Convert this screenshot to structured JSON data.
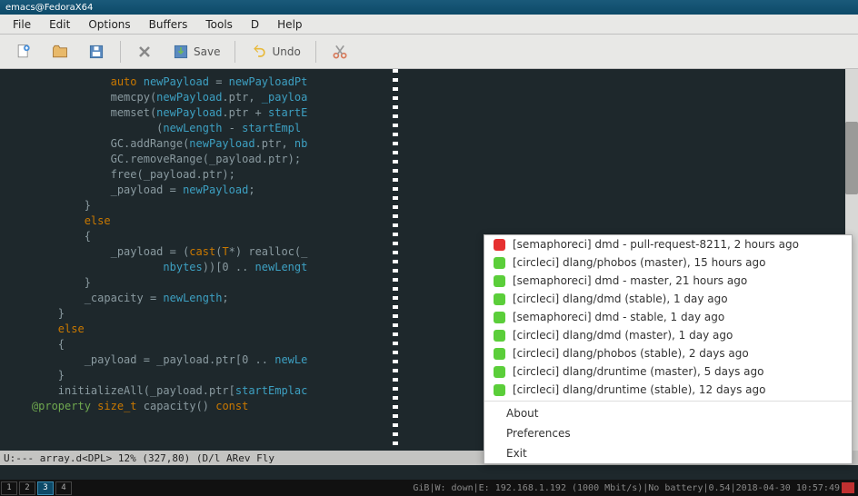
{
  "window": {
    "title": "emacs@FedoraX64"
  },
  "menubar": [
    "File",
    "Edit",
    "Options",
    "Buffers",
    "Tools",
    "D",
    "Help"
  ],
  "toolbar": {
    "new": "",
    "open": "",
    "saveicon": "",
    "close": "",
    "save": "Save",
    "undo": "Undo",
    "cut": ""
  },
  "code": {
    "lines": [
      "                auto newPayload = newPayloadPt",
      "                memcpy(newPayload.ptr, _payloa",
      "                memset(newPayload.ptr + startE",
      "                       (newLength - startEmpl",
      "                GC.addRange(newPayload.ptr, nb",
      "                GC.removeRange(_payload.ptr);",
      "                free(_payload.ptr);",
      "                _payload = newPayload;",
      "            }",
      "            else",
      "            {",
      "                _payload = (cast(T*) realloc(_",
      "                        nbytes))[0 .. newLengt",
      "            }",
      "            _capacity = newLength;",
      "        }",
      "        else",
      "        {",
      "            _payload = _payload.ptr[0 .. newLe",
      "        }",
      "        initializeAll(_payload.ptr[startEmplac",
      "",
      "    @property size_t capacity() const"
    ]
  },
  "modeline": "U:---  array.d<DPL>   12% (327,80)   (D/l ARev Fly",
  "popup": {
    "items": [
      {
        "status": "red",
        "text": "[semaphoreci] dmd - pull-request-8211, 2 hours ago"
      },
      {
        "status": "green",
        "text": "[circleci] dlang/phobos (master), 15 hours ago"
      },
      {
        "status": "green",
        "text": "[semaphoreci] dmd - master, 21 hours ago"
      },
      {
        "status": "green",
        "text": "[circleci] dlang/dmd (stable), 1 day ago"
      },
      {
        "status": "green",
        "text": "[semaphoreci] dmd - stable, 1 day ago"
      },
      {
        "status": "green",
        "text": "[circleci] dlang/dmd (master), 1 day ago"
      },
      {
        "status": "green",
        "text": "[circleci] dlang/phobos (stable), 2 days ago"
      },
      {
        "status": "green",
        "text": "[circleci] dlang/druntime (master), 5 days ago"
      },
      {
        "status": "green",
        "text": "[circleci] dlang/druntime (stable), 12 days ago"
      }
    ],
    "menu": [
      "About",
      "Preferences",
      "Exit"
    ]
  },
  "taskbar": {
    "workspaces": [
      "1",
      "2",
      "3",
      "4"
    ],
    "active": 2,
    "right": " GiB|W: down|E: 192.168.1.192 (1000 Mbit/s)|No battery|0.54|2018-04-30 10:57:49 "
  }
}
